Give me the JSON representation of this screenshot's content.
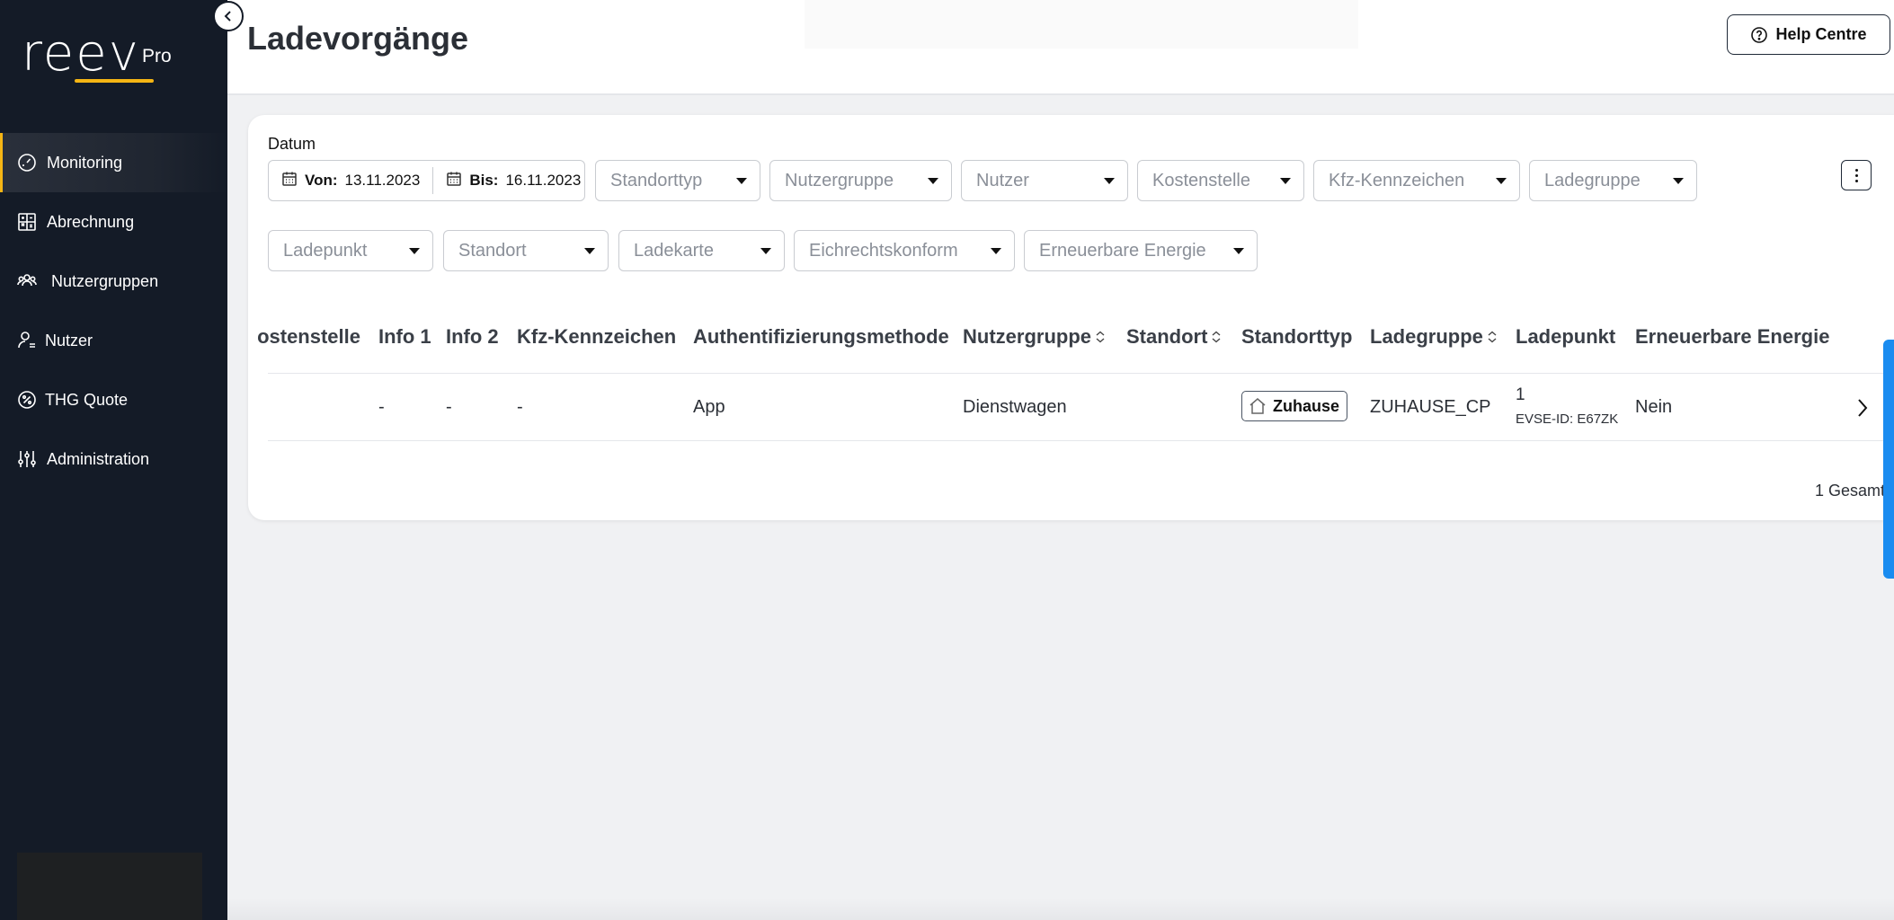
{
  "app": {
    "logo_text": "reev",
    "logo_badge": "Pro",
    "accent": "#f5b514",
    "sidebar_bg": "#141b27"
  },
  "sidebar": {
    "items": [
      {
        "label": "Monitoring",
        "icon": "gauge-icon",
        "active": true
      },
      {
        "label": "Abrechnung",
        "icon": "calculator-icon"
      },
      {
        "label": "Nutzergruppen",
        "icon": "users-group-icon"
      },
      {
        "label": "Nutzer",
        "icon": "user-icon"
      },
      {
        "label": "THG Quote",
        "icon": "percent-badge-icon"
      },
      {
        "label": "Administration",
        "icon": "sliders-icon"
      }
    ]
  },
  "header": {
    "title": "Ladevorgänge",
    "help_label": "Help Centre"
  },
  "filters": {
    "date_label": "Datum",
    "from_label": "Von:",
    "from_value": "13.11.2023",
    "to_label": "Bis:",
    "to_value": "16.11.2023",
    "row1": [
      "Standorttyp",
      "Nutzergruppe",
      "Nutzer",
      "Kostenstelle",
      "Kfz-Kennzeichen",
      "Ladegruppe"
    ],
    "row2": [
      "Ladepunkt",
      "Standort",
      "Ladekarte",
      "Eichrechtskonform",
      "Erneuerbare Energie"
    ]
  },
  "table": {
    "columns": [
      "ostenstelle",
      "Info 1",
      "Info 2",
      "Kfz-Kennzeichen",
      "Authentifizierungsmethode",
      "Nutzergruppe",
      "Standort",
      "Standorttyp",
      "Ladegruppe",
      "Ladepunkt",
      "Erneuerbare Energie"
    ],
    "rows": [
      {
        "info1": "-",
        "info2": "-",
        "kfz": "-",
        "auth": "App",
        "nutzergruppe": "Dienstwagen",
        "standorttyp": "Zuhause",
        "ladegruppe": "ZUHAUSE_CP",
        "ladepunkt": "1",
        "evse": "EVSE-ID: E67ZK",
        "erneuerbar": "Nein"
      }
    ],
    "total": "1 Gesamt"
  }
}
